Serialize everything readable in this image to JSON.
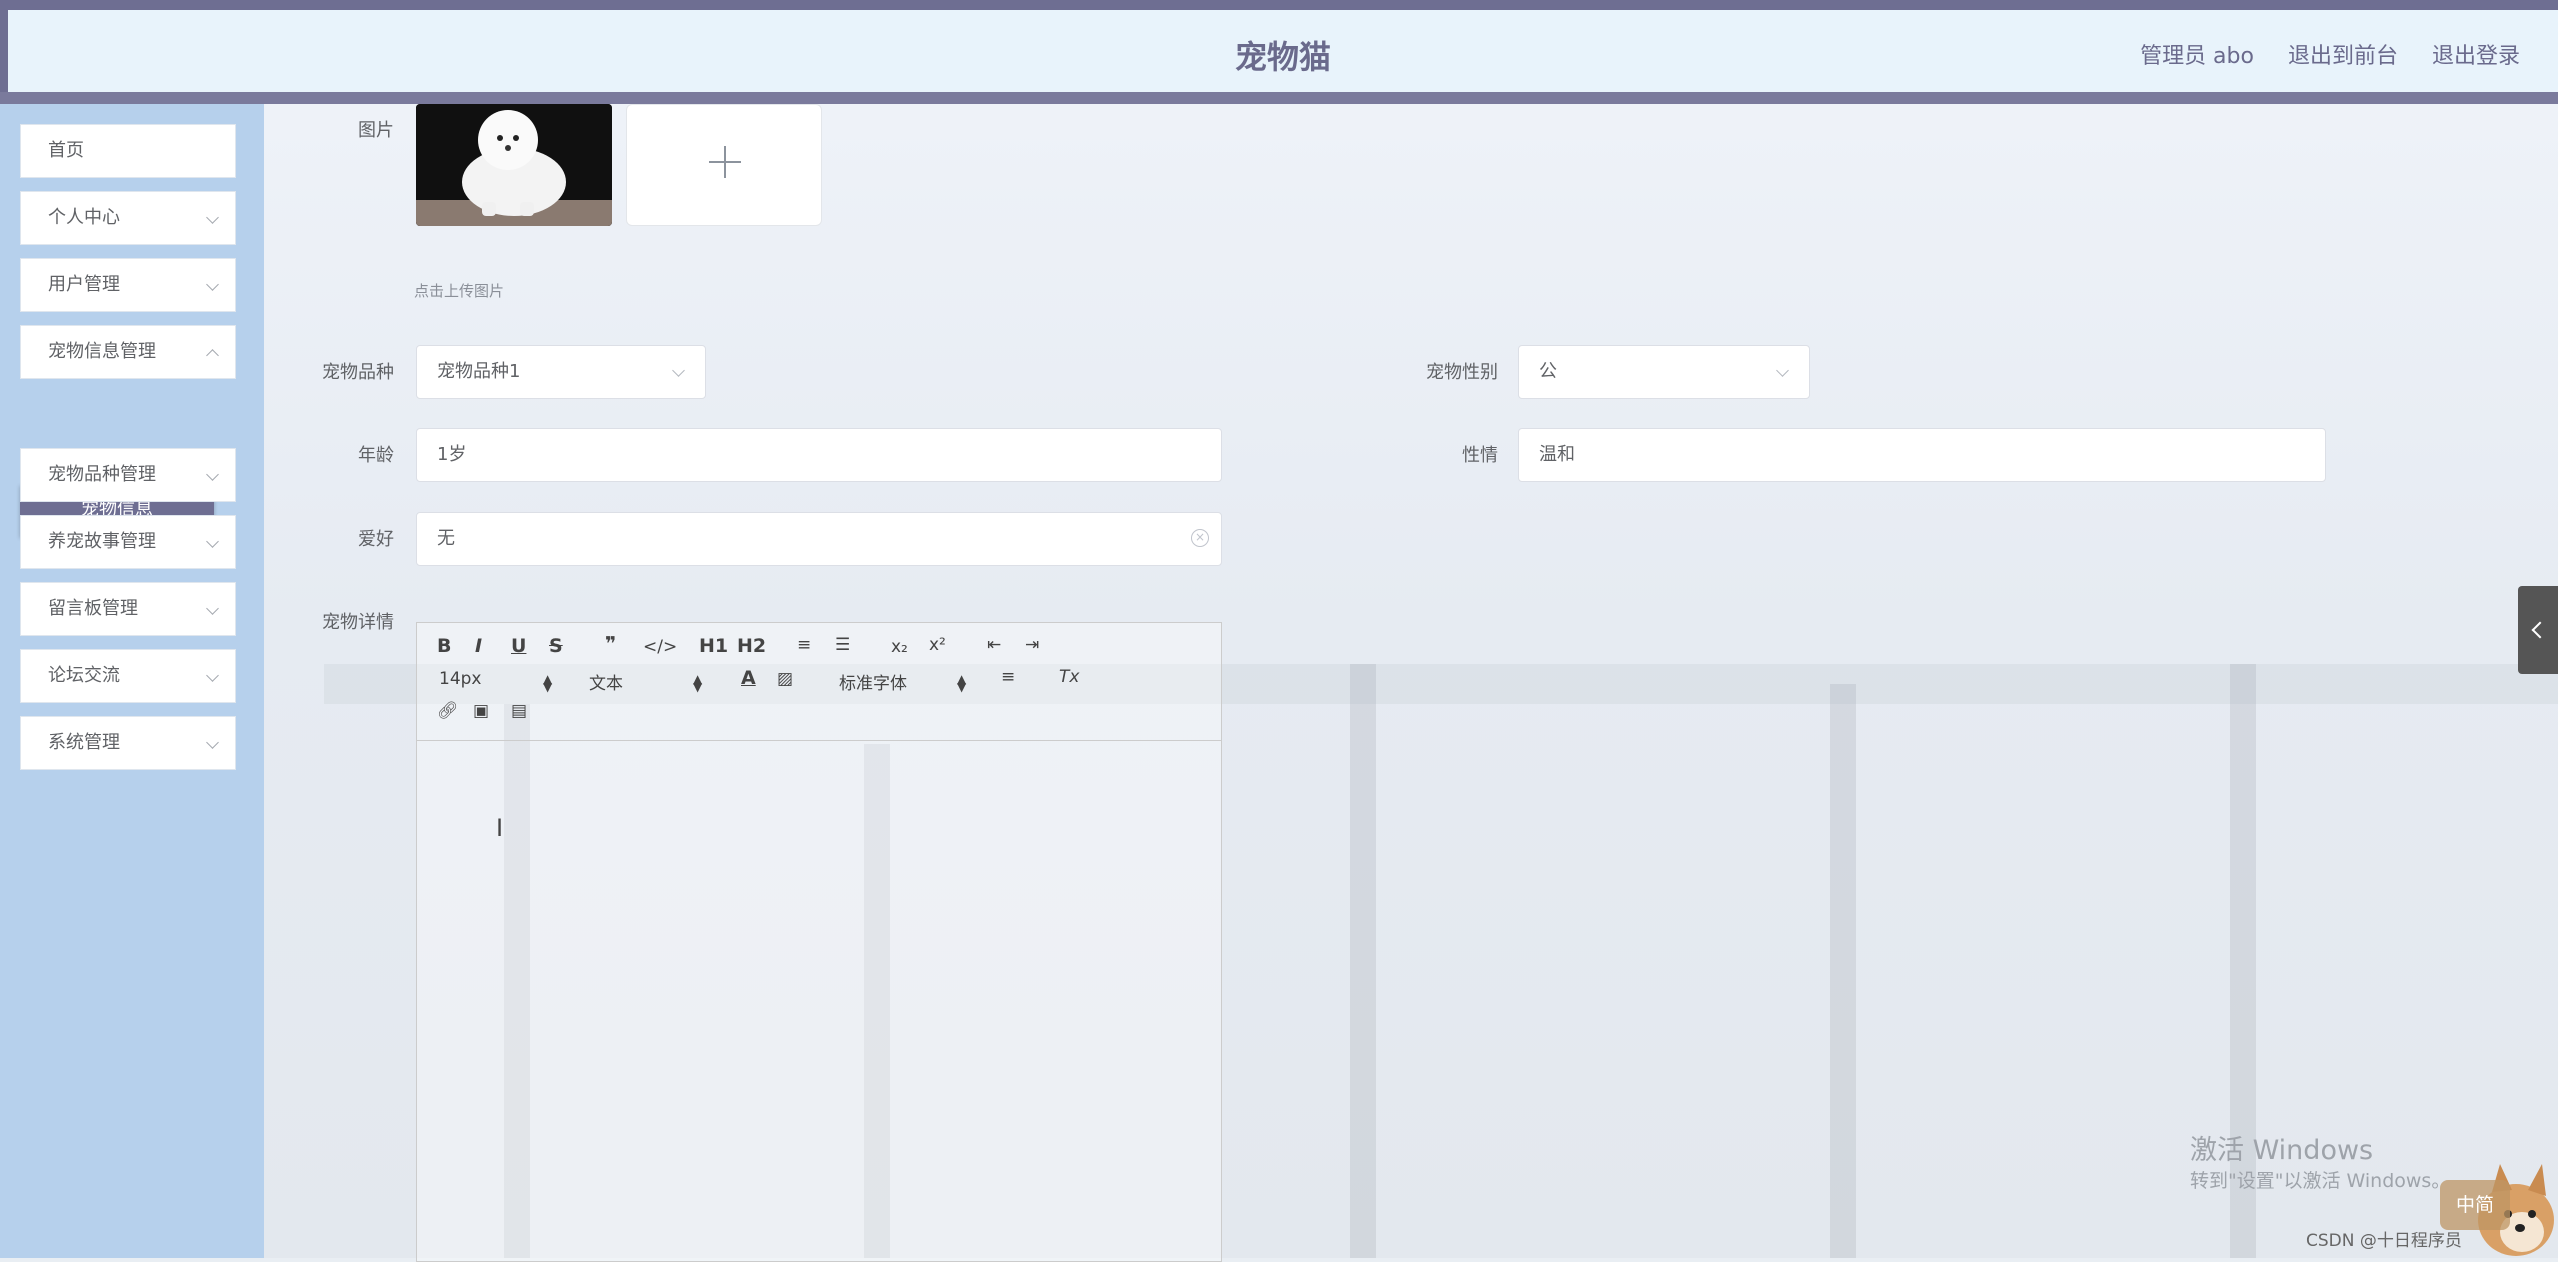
{
  "header": {
    "title": "宠物猫",
    "admin_label": "管理员 abo",
    "front_link": "退出到前台",
    "logout_link": "退出登录"
  },
  "sidebar": {
    "items": [
      {
        "label": "首页"
      },
      {
        "label": "个人中心"
      },
      {
        "label": "用户管理"
      },
      {
        "label": "宠物信息管理"
      },
      {
        "label": "宠物品种管理"
      },
      {
        "label": "养宠故事管理"
      },
      {
        "label": "留言板管理"
      },
      {
        "label": "论坛交流"
      },
      {
        "label": "系统管理"
      }
    ],
    "active_sub": "宠物信息"
  },
  "form": {
    "image_label": "图片",
    "upload_tip": "点击上传图片",
    "breed_label": "宠物品种",
    "breed_value": "宠物品种1",
    "gender_label": "宠物性别",
    "gender_value": "公",
    "age_label": "年龄",
    "age_value": "1岁",
    "temper_label": "性情",
    "temper_value": "温和",
    "hobby_label": "爱好",
    "hobby_value": "无",
    "detail_label": "宠物详情"
  },
  "editor": {
    "font_size": "14px",
    "paragraph": "文本",
    "font_family": "标准字体",
    "h1": "H1",
    "h2": "H2"
  },
  "overlay": {
    "win_activate": "激活 Windows",
    "win_hint": "转到\"设置\"以激活 Windows。",
    "csdn": "CSDN @十日程序员",
    "mascot_text": "中简"
  },
  "colors": {
    "primary": "#6e6e92",
    "sidebar_bg": "#b6d0ec",
    "header_bg": "#e8f3fb"
  }
}
